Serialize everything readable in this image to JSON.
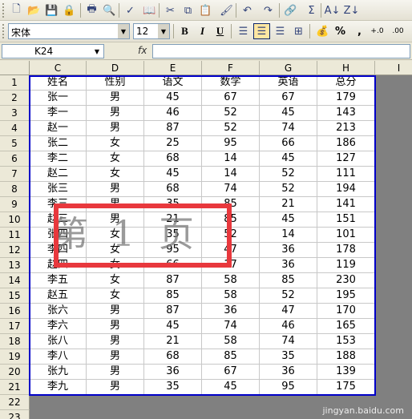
{
  "toolbar1": {
    "icons": [
      "new-icon",
      "open-icon",
      "save-icon",
      "permission-icon",
      "print-icon",
      "print-preview-icon",
      "spelling-icon",
      "research-icon",
      "cut-icon",
      "copy-icon",
      "paste-icon",
      "format-painter-icon",
      "undo-icon",
      "redo-icon",
      "hyperlink-icon",
      "autosum-icon",
      "sort-ascending-icon",
      "sort-descending-icon"
    ],
    "glyphs": [
      "🗋",
      "📂",
      "💾",
      "🔒",
      "🖶",
      "🔍",
      "✓",
      "📖",
      "✂",
      "⧉",
      "📋",
      "🖌",
      "↶",
      "↷",
      "🔗",
      "Σ",
      "A↓",
      "Z↓"
    ]
  },
  "toolbar2": {
    "font_name": "宋体",
    "font_size": "12",
    "bold": "B",
    "italic": "I",
    "underline": "U",
    "percent": "%",
    "comma": ",",
    "inc_decimal": "+.0",
    "dec_decimal": ".00"
  },
  "formula_bar": {
    "name_box": "K24",
    "fx": "fx",
    "value": ""
  },
  "columns": [
    "C",
    "D",
    "E",
    "F",
    "G",
    "H",
    "I"
  ],
  "rows": [
    "1",
    "2",
    "3",
    "4",
    "5",
    "6",
    "7",
    "8",
    "9",
    "10",
    "11",
    "12",
    "13",
    "14",
    "15",
    "16",
    "17",
    "18",
    "19",
    "20",
    "21",
    "22",
    "23"
  ],
  "table": [
    [
      "姓名",
      "性别",
      "语文",
      "数学",
      "英语",
      "总分"
    ],
    [
      "张一",
      "男",
      "45",
      "67",
      "67",
      "179"
    ],
    [
      "李一",
      "男",
      "46",
      "52",
      "45",
      "143"
    ],
    [
      "赵一",
      "男",
      "87",
      "52",
      "74",
      "213"
    ],
    [
      "张二",
      "女",
      "25",
      "95",
      "66",
      "186"
    ],
    [
      "李二",
      "女",
      "68",
      "14",
      "45",
      "127"
    ],
    [
      "赵二",
      "女",
      "45",
      "14",
      "52",
      "111"
    ],
    [
      "张三",
      "男",
      "68",
      "74",
      "52",
      "194"
    ],
    [
      "李三",
      "男",
      "35",
      "85",
      "21",
      "141"
    ],
    [
      "赵三",
      "男",
      "21",
      "85",
      "45",
      "151"
    ],
    [
      "张四",
      "女",
      "35",
      "52",
      "14",
      "101"
    ],
    [
      "李四",
      "女",
      "95",
      "47",
      "36",
      "178"
    ],
    [
      "赵四",
      "女",
      "66",
      "17",
      "36",
      "119"
    ],
    [
      "李五",
      "女",
      "87",
      "58",
      "85",
      "230"
    ],
    [
      "赵五",
      "女",
      "85",
      "58",
      "52",
      "195"
    ],
    [
      "张六",
      "男",
      "87",
      "36",
      "47",
      "170"
    ],
    [
      "李六",
      "男",
      "45",
      "74",
      "46",
      "165"
    ],
    [
      "张八",
      "男",
      "21",
      "58",
      "74",
      "153"
    ],
    [
      "李八",
      "男",
      "68",
      "85",
      "35",
      "188"
    ],
    [
      "张九",
      "男",
      "36",
      "67",
      "36",
      "139"
    ],
    [
      "李九",
      "男",
      "35",
      "45",
      "95",
      "175"
    ]
  ],
  "watermark": "第 1 页",
  "credit": "jingyan.baidu.com",
  "colors": {
    "page_border": "#0000c8",
    "highlight": "#e8383d",
    "outside_page": "#808080"
  }
}
